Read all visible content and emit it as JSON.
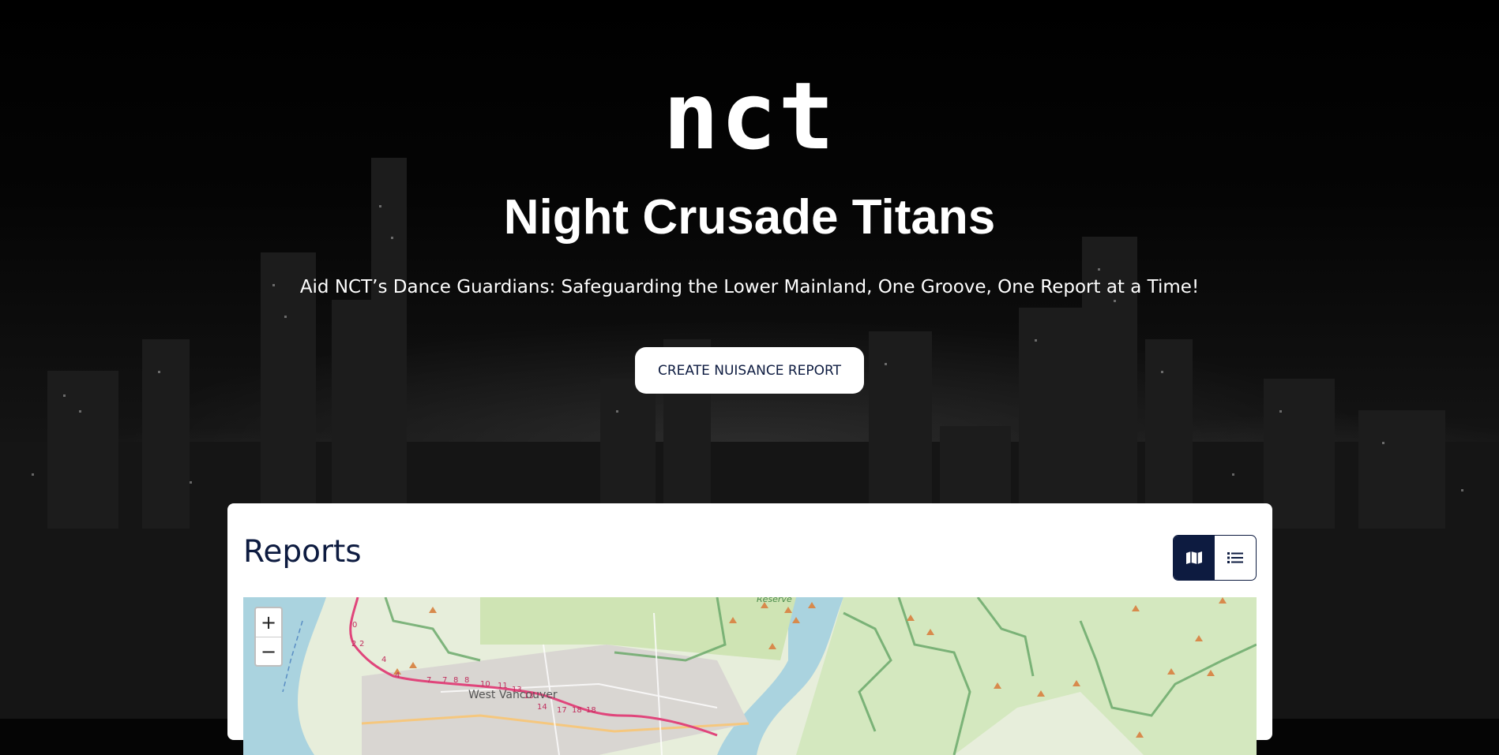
{
  "hero": {
    "logo_text": "nct",
    "title": "Night Crusade Titans",
    "subtitle": "Aid NCT’s Dance Guardians: Safeguarding the Lower Mainland, One Groove, One Report at a Time!",
    "cta_label": "CREATE NUISANCE REPORT"
  },
  "reports": {
    "heading": "Reports",
    "view_toggle": [
      {
        "icon": "map-icon",
        "active": true
      },
      {
        "icon": "list-icon",
        "active": false
      }
    ],
    "map": {
      "zoom_in": "+",
      "zoom_out": "−",
      "place_labels": [
        "West Vancouver",
        "Reserve"
      ],
      "route_markers": [
        "0",
        "2",
        "2",
        "4",
        "4",
        "7",
        "7",
        "8",
        "8",
        "10",
        "11",
        "13",
        "13",
        "14",
        "17",
        "18",
        "18"
      ]
    }
  },
  "colors": {
    "navy": "#0d1b40",
    "map_land": "#e7eedb",
    "map_water": "#aad3df",
    "route": "#e0457b",
    "park_border": "#6ba96b"
  }
}
